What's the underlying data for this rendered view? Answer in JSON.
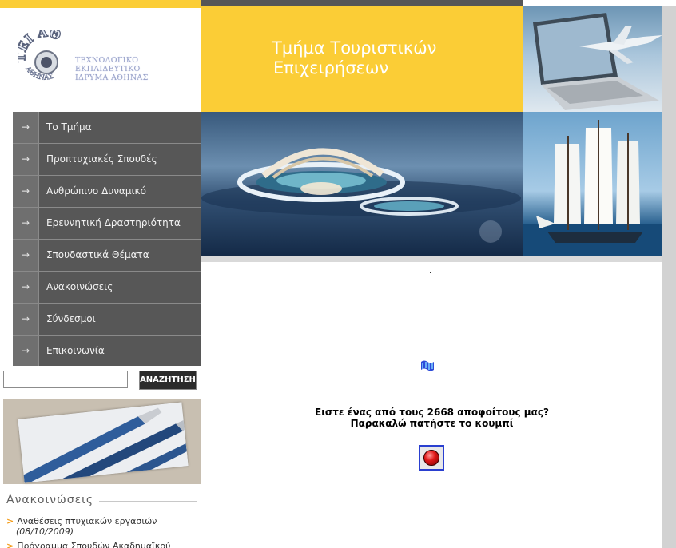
{
  "logo": {
    "seal_text": "ΤΕΙ ΑΘΗΝΑΣ",
    "line1": "ΤΕΧΝΟΛΟΓΙΚΟ ΕΚΠΑΙΔΕΥΤΙΚΟ",
    "line2": "ΙΔΡΥΜΑ ΑΘΗΝΑΣ"
  },
  "banner": {
    "title_line1": "Τμήμα Τουριστικών",
    "title_line2": "Επιχειρήσεων"
  },
  "menu": {
    "arrow_icon": "→",
    "items": [
      {
        "label": "Το Τμήμα"
      },
      {
        "label": "Προπτυχιακές Σπουδές"
      },
      {
        "label": "Ανθρώπινο Δυναμικό"
      },
      {
        "label": "Ερευνητική Δραστηριότητα"
      },
      {
        "label": "Σπουδαστικά Θέματα"
      },
      {
        "label": "Ανακοινώσεις"
      },
      {
        "label": "Σύνδεσμοι"
      },
      {
        "label": "Επικοινωνία"
      }
    ]
  },
  "search": {
    "value": "",
    "button_label": "ΑΝΑΖΗΤΗΣΗ"
  },
  "announcements": {
    "title": "Ανακοινώσεις",
    "items": [
      {
        "title": "Αναθέσεις πτυχιακών εργασιών",
        "date": "(08/10/2009)"
      },
      {
        "title": "Πρόγραμμα Σπουδών Ακαδημαϊκού",
        "date": ""
      }
    ]
  },
  "content": {
    "dot": ".",
    "alumni_line1": "Ειστε ένας από τους 2668 αποφοίτους μας?",
    "alumni_line2": "Παρακαλώ πατήστε το κουμπί"
  },
  "colors": {
    "banner_yellow": "#fbcd36",
    "menu_bg": "#575757",
    "bullet_orange": "#f39c1a",
    "button_border": "#2a3fd0"
  }
}
